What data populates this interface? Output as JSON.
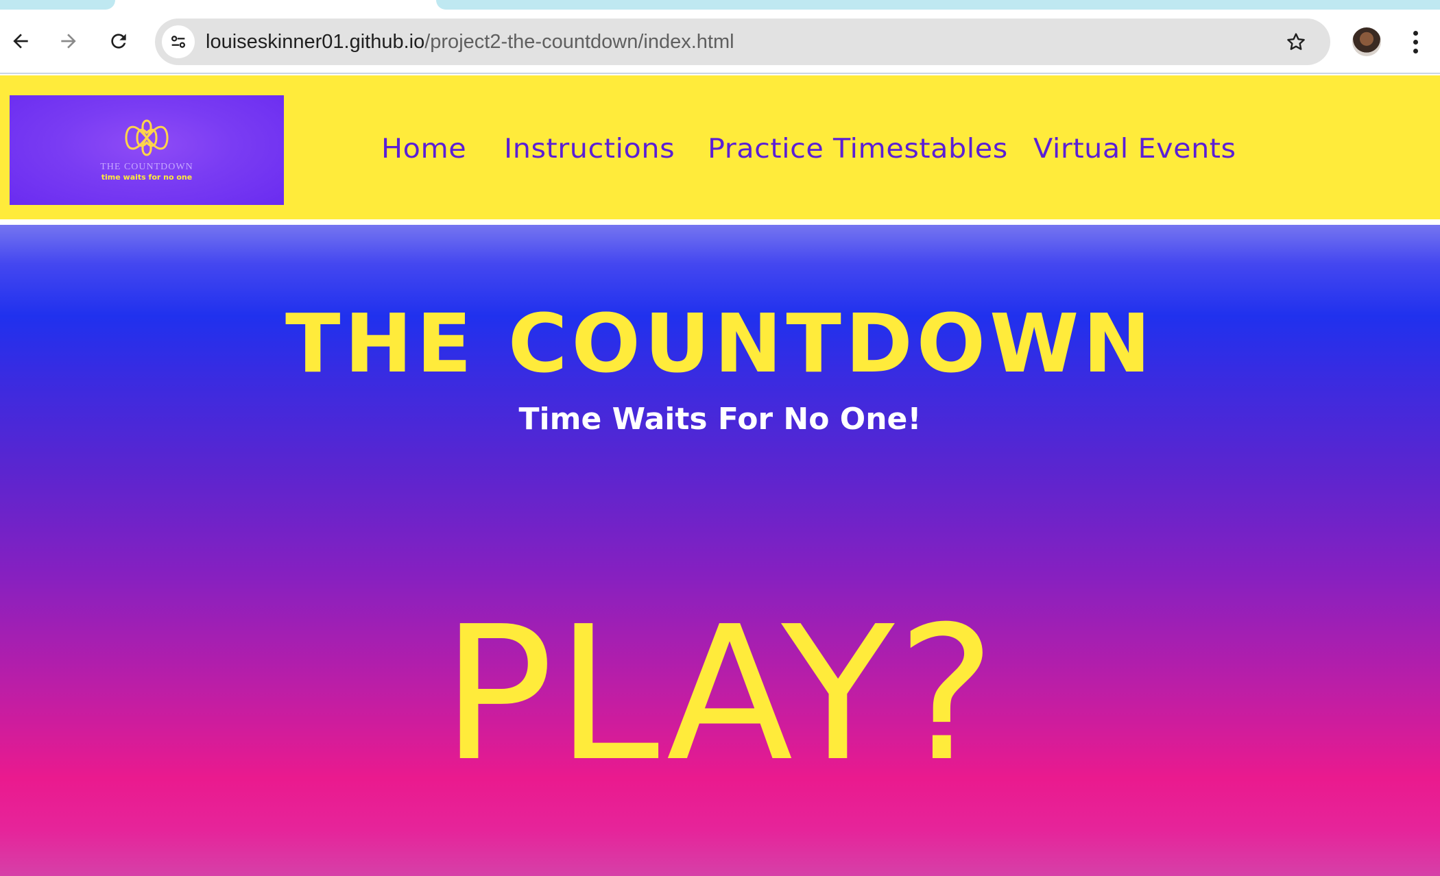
{
  "browser": {
    "url_host": "louiseskinner01.github.io",
    "url_path": "/project2-the-countdown/index.html",
    "icons": {
      "back": "arrow-left-icon",
      "forward": "arrow-right-icon",
      "reload": "reload-icon",
      "site_info": "tune-icon",
      "bookmark": "star-icon",
      "profile": "avatar",
      "menu": "more-vert-icon"
    }
  },
  "header": {
    "logo": {
      "title": "THE COUNTDOWN",
      "tagline": "time waits for no one"
    },
    "nav": [
      {
        "label": "Home"
      },
      {
        "label": "Instructions"
      },
      {
        "label": "Practice Timestables"
      },
      {
        "label": "Virtual Events"
      }
    ]
  },
  "hero": {
    "title": "THE COUNTDOWN",
    "subtitle": "Time Waits For No One!",
    "play_label": "PLAY?"
  },
  "colors": {
    "header_bg": "#ffeb3b",
    "nav_text": "#5a1fd6",
    "accent_yellow": "#ffeb3b",
    "gradient_top": "#2031ee",
    "gradient_bottom": "#ea1a8e"
  }
}
